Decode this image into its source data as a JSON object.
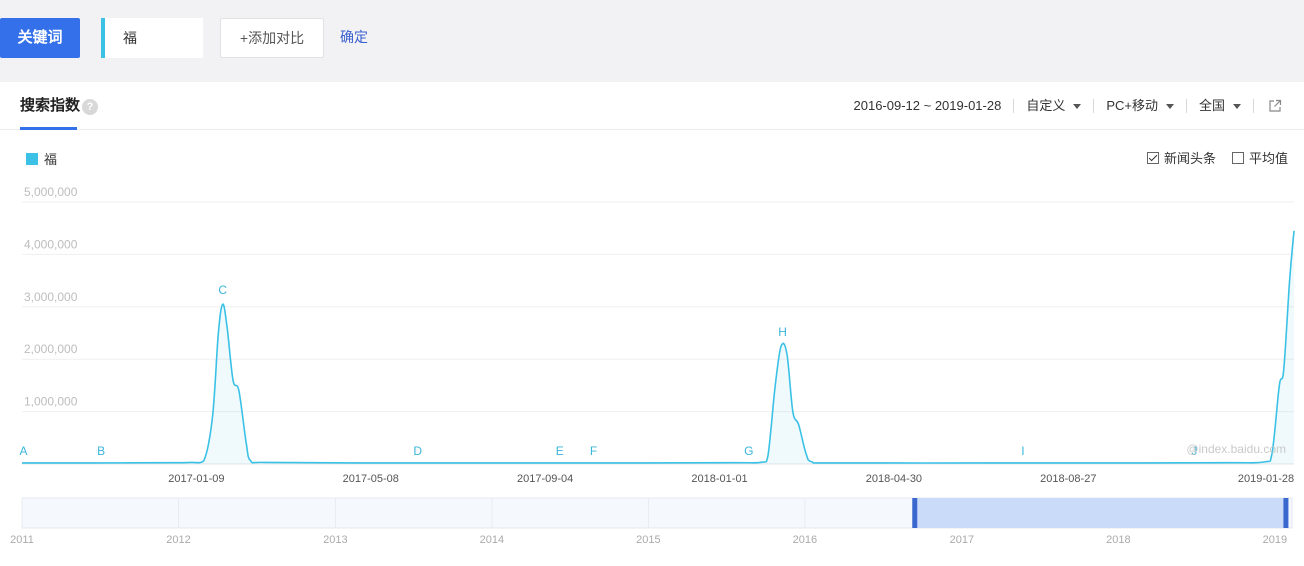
{
  "topbar": {
    "keyword_button": "关键词",
    "keyword_value": "福",
    "add_compare": "+添加对比",
    "confirm": "确定"
  },
  "tabs": {
    "title": "搜索指数",
    "help": "?"
  },
  "filters": {
    "date_range": "2016-09-12 ~ 2019-01-28",
    "custom": "自定义",
    "device": "PC+移动",
    "region": "全国"
  },
  "options": {
    "news": "新闻头条",
    "news_checked": true,
    "average": "平均值",
    "average_checked": false
  },
  "colors": {
    "accent": "#3370ea",
    "series": "#3ac1e5"
  },
  "icons": {
    "help": "help-icon",
    "share": "share-icon"
  },
  "chart_data": {
    "type": "line",
    "title": "",
    "legend": "top-left",
    "grid": true,
    "y_ticks": [
      "5,000,000",
      "4,000,000",
      "3,000,000",
      "2,000,000",
      "1,000,000"
    ],
    "ylim": [
      0,
      5000000
    ],
    "x_range": [
      "2016-09-12",
      "2019-01-28"
    ],
    "x_ticks": [
      "2017-01-09",
      "2017-05-08",
      "2017-09-04",
      "2018-01-01",
      "2018-04-30",
      "2018-08-27",
      "2019-01-28"
    ],
    "series": [
      {
        "name": "福",
        "points": [
          [
            "2016-09-12",
            20000
          ],
          [
            "2016-10-30",
            20000
          ],
          [
            "2016-12-20",
            25000
          ],
          [
            "2017-01-05",
            30000
          ],
          [
            "2017-01-14",
            60000
          ],
          [
            "2017-01-20",
            900000
          ],
          [
            "2017-01-24",
            2500000
          ],
          [
            "2017-01-27",
            3050000
          ],
          [
            "2017-01-30",
            2600000
          ],
          [
            "2017-02-03",
            1600000
          ],
          [
            "2017-02-07",
            1400000
          ],
          [
            "2017-02-12",
            400000
          ],
          [
            "2017-02-15",
            60000
          ],
          [
            "2017-02-25",
            30000
          ],
          [
            "2017-05-01",
            20000
          ],
          [
            "2017-08-01",
            20000
          ],
          [
            "2017-11-01",
            20000
          ],
          [
            "2018-01-10",
            25000
          ],
          [
            "2018-01-30",
            35000
          ],
          [
            "2018-02-03",
            150000
          ],
          [
            "2018-02-08",
            1500000
          ],
          [
            "2018-02-12",
            2250000
          ],
          [
            "2018-02-16",
            2100000
          ],
          [
            "2018-02-20",
            1000000
          ],
          [
            "2018-02-24",
            750000
          ],
          [
            "2018-03-01",
            200000
          ],
          [
            "2018-03-05",
            40000
          ],
          [
            "2018-03-20",
            20000
          ],
          [
            "2018-07-01",
            20000
          ],
          [
            "2018-10-01",
            20000
          ],
          [
            "2018-12-15",
            25000
          ],
          [
            "2019-01-08",
            40000
          ],
          [
            "2019-01-13",
            200000
          ],
          [
            "2019-01-18",
            1500000
          ],
          [
            "2019-01-21",
            1800000
          ],
          [
            "2019-01-25",
            3500000
          ],
          [
            "2019-01-28",
            4450000
          ]
        ]
      }
    ],
    "annotations": [
      {
        "label": "A",
        "date": "2016-09-13"
      },
      {
        "label": "B",
        "date": "2016-11-05"
      },
      {
        "label": "C",
        "date": "2017-01-27",
        "value": 3050000
      },
      {
        "label": "D",
        "date": "2017-06-09"
      },
      {
        "label": "E",
        "date": "2017-09-14"
      },
      {
        "label": "F",
        "date": "2017-10-07"
      },
      {
        "label": "G",
        "date": "2018-01-21"
      },
      {
        "label": "H",
        "date": "2018-02-13",
        "value": 2250000
      },
      {
        "label": "I",
        "date": "2018-07-27"
      },
      {
        "label": "J",
        "date": "2018-11-21"
      }
    ],
    "watermark": "@index.baidu.com",
    "overview": {
      "year_ticks": [
        "2011",
        "2012",
        "2013",
        "2014",
        "2015",
        "2016",
        "2017",
        "2018",
        "2019"
      ],
      "range": [
        "2011-01-01",
        "2019-02-10"
      ],
      "selection": [
        "2016-09-12",
        "2019-01-28"
      ]
    }
  }
}
